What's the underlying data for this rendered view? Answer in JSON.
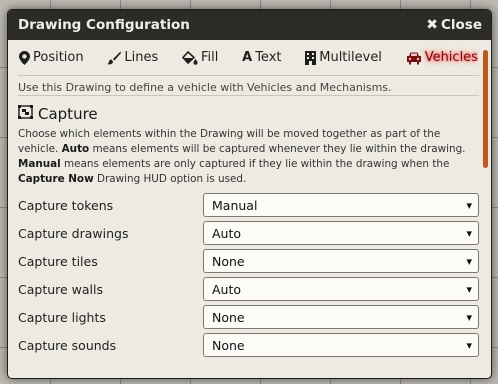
{
  "colors": {
    "accent": "#c2561a",
    "active_tab": "#7a1010",
    "titlebar": "#2c2b28"
  },
  "title": "Drawing Configuration",
  "close": {
    "icon": "✖",
    "label": "Close"
  },
  "tabs": [
    {
      "icon": "map-marker-icon",
      "glyph": "⚲",
      "label": "Position"
    },
    {
      "icon": "brush-icon",
      "glyph": "✎",
      "label": "Lines"
    },
    {
      "icon": "fill-bucket-icon",
      "glyph": "◧",
      "label": "Fill"
    },
    {
      "icon": "font-icon",
      "glyph": "A",
      "label": "Text"
    },
    {
      "icon": "building-icon",
      "glyph": "▮",
      "label": "Multilevel"
    },
    {
      "icon": "vehicle-icon",
      "glyph": "⛟",
      "label": "Vehicles",
      "active": true
    }
  ],
  "hint": "Use this Drawing to define a vehicle with Vehicles and Mechanisms.",
  "section": {
    "icon": "object-group-icon",
    "title": "Capture",
    "notes_1": "Choose which elements within the Drawing will be moved together as part of the vehicle.",
    "notes_auto": "Auto",
    "notes_2": "means elements will be captured whenever they lie within the drawing.",
    "notes_manual": "Manual",
    "notes_3": "means elements are only captured if they lie within the drawing when the",
    "notes_capture_now": "Capture Now",
    "notes_4": "Drawing HUD option is used."
  },
  "fields": [
    {
      "label": "Capture tokens",
      "value": "Manual"
    },
    {
      "label": "Capture drawings",
      "value": "Auto"
    },
    {
      "label": "Capture tiles",
      "value": "None"
    },
    {
      "label": "Capture walls",
      "value": "Auto"
    },
    {
      "label": "Capture lights",
      "value": "None"
    },
    {
      "label": "Capture sounds",
      "value": "None"
    }
  ]
}
